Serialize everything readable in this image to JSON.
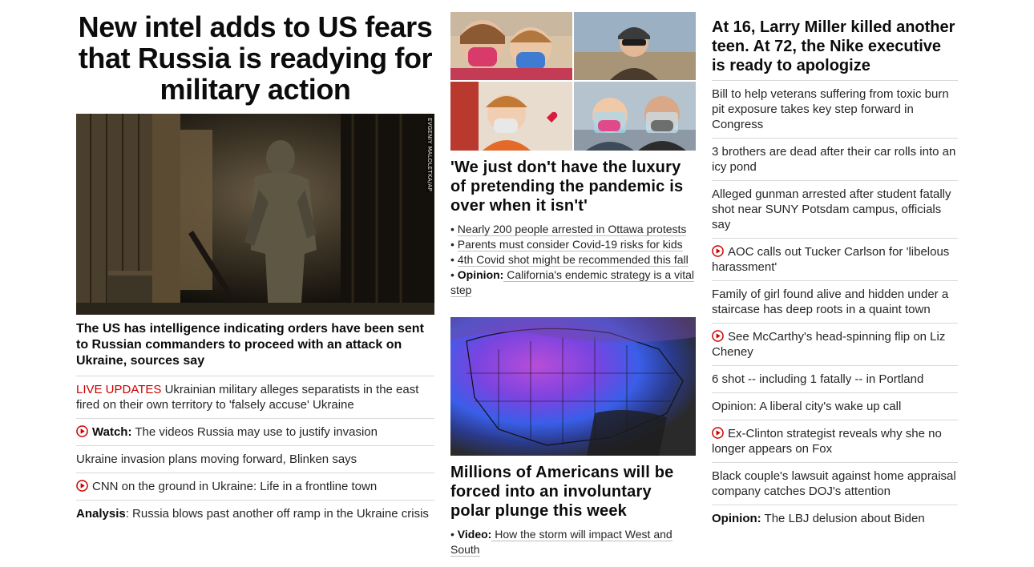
{
  "col1": {
    "headline": "New intel adds to US fears that Russia is readying for military action",
    "image_credit": "EVGENIY MALOLETKA/AP",
    "caption": "The US has intelligence indicating orders have been sent to Russian commanders to proceed with an attack on Ukraine, sources say",
    "items": [
      {
        "prefix": "LIVE UPDATES",
        "text": " Ukrainian military alleges separatists in the east fired on their own territory to 'falsely accuse' Ukraine"
      },
      {
        "prefix": "Watch:",
        "text": " The videos Russia may use to justify invasion"
      },
      {
        "text": "Ukraine invasion plans moving forward, Blinken says"
      },
      {
        "text": "CNN on the ground in Ukraine: Life in a frontline town"
      },
      {
        "prefix": "Analysis",
        "text": ": Russia blows past another off ramp in the Ukraine crisis"
      }
    ]
  },
  "col2": {
    "headline1": "'We just don't have the luxury of pretending the pandemic is over when it isn't'",
    "bullets1": [
      {
        "text": "Nearly 200 people arrested in Ottawa protests"
      },
      {
        "text": "Parents must consider Covid-19 risks for kids"
      },
      {
        "text": "4th Covid shot might be recommended this fall"
      },
      {
        "prefix": "Opinion:",
        "text": " California's endemic strategy is a vital step"
      }
    ],
    "headline2": "Millions of Americans will be forced into an involuntary polar plunge this week",
    "bullets2": [
      {
        "prefix": "Video:",
        "text": " How the storm will impact West and South"
      }
    ]
  },
  "col3": {
    "headline": "At 16, Larry Miller killed another teen. At 72, the Nike executive is ready to apologize",
    "items": [
      {
        "text": "Bill to help veterans suffering from toxic burn pit exposure takes key step forward in Congress"
      },
      {
        "text": "3 brothers are dead after their car rolls into an icy pond"
      },
      {
        "text": "Alleged gunman arrested after student fatally shot near SUNY Potsdam campus, officials say"
      },
      {
        "text": "AOC calls out Tucker Carlson for 'libelous harassment'"
      },
      {
        "text": "Family of girl found alive and hidden under a staircase has deep roots in a quaint town"
      },
      {
        "text": "See McCarthy's head-spinning flip on Liz Cheney"
      },
      {
        "text": "6 shot -- including 1 fatally -- in Portland"
      },
      {
        "text": "Opinion: A liberal city's wake up call"
      },
      {
        "text": "Ex-Clinton strategist reveals why she no longer appears on Fox"
      },
      {
        "text": "Black couple's lawsuit against home appraisal company catches DOJ's attention"
      },
      {
        "prefix": "Opinion:",
        "text": " The LBJ delusion about Biden"
      }
    ]
  },
  "colors": {
    "live": "#cc0000",
    "play_icon": "#cc0000",
    "divider": "#d9d9d9"
  }
}
